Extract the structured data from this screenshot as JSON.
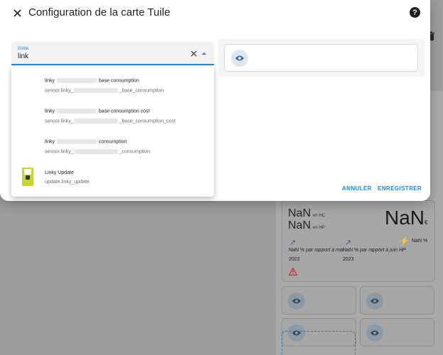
{
  "dialog": {
    "title": "Configuration de la carte Tuile",
    "help_label": "?"
  },
  "entity_field": {
    "label": "Entité",
    "value": "link"
  },
  "options": [
    {
      "name_start": "linky ",
      "name_end": " base consumption",
      "id_start": "sensor.linky_",
      "id_end": "_base_consumption"
    },
    {
      "name_start": "linky ",
      "name_end": " base consumption cost",
      "id_start": "sensor.linky_",
      "id_end": "_base_consumption_cost"
    },
    {
      "name_start": "linky ",
      "name_end": " consumption",
      "id_start": "sensor.linky_",
      "id_end": "_consumption"
    },
    {
      "name": "Linky Update",
      "id": "update.linky_update",
      "icon": "linky-meter-icon"
    }
  ],
  "buttons": {
    "cancel": "ANNULER",
    "save": "ENREGISTRER"
  },
  "background": {
    "nan": "NaN",
    "hc_label": "en HC",
    "hp_label": "en HP",
    "currency": "€",
    "stat1_value": "NaN %",
    "stat1_text": "par rapport à mai",
    "stat1_year": "2023",
    "stat2_value": "NaN %",
    "stat2_text": "par rapport à juin HP",
    "stat2_year": "2023",
    "stat3_value": "NaN %"
  },
  "colors": {
    "accent": "#1e88e5",
    "linky_icon": "#c5d827"
  }
}
